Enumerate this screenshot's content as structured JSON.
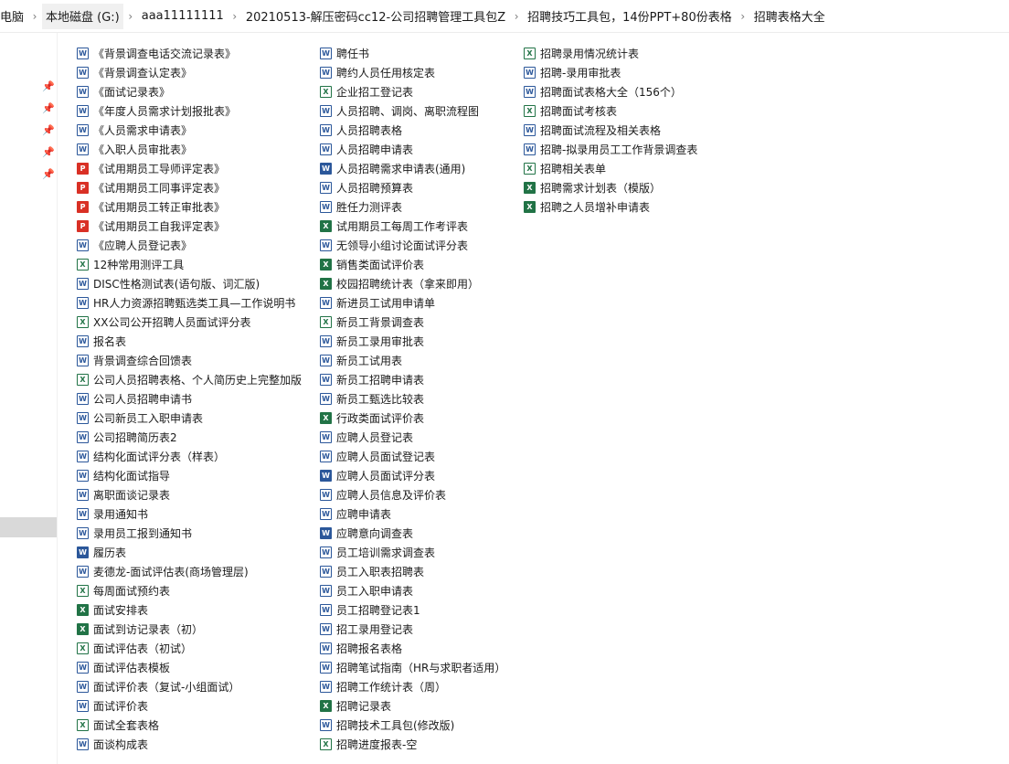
{
  "breadcrumb": [
    "电脑",
    "本地磁盘 (G:)",
    "aaa11111111",
    "20210513-解压密码cc12-公司招聘管理工具包Z",
    "招聘技巧工具包，14份PPT+80份表格",
    "招聘表格大全"
  ],
  "breadcrumb_separator": "›",
  "pin_glyph": "📌",
  "icon_types": {
    "word": {
      "glyph": "W",
      "color": "#2b579a"
    },
    "excel": {
      "glyph": "X",
      "color": "#217346"
    },
    "pdf": {
      "glyph": "P",
      "color": "#d93025"
    },
    "doc": {
      "glyph": "W",
      "color": "#2b579a"
    },
    "xls": {
      "glyph": "X",
      "color": "#217346"
    }
  },
  "files": {
    "col1": [
      {
        "name": "《背景调查电话交流记录表》",
        "icon": "doc"
      },
      {
        "name": "《背景调查认定表》",
        "icon": "doc"
      },
      {
        "name": "《面试记录表》",
        "icon": "doc"
      },
      {
        "name": "《年度人员需求计划报批表》",
        "icon": "doc"
      },
      {
        "name": "《人员需求申请表》",
        "icon": "doc"
      },
      {
        "name": "《入职人员审批表》",
        "icon": "doc"
      },
      {
        "name": "《试用期员工导师评定表》",
        "icon": "pdf"
      },
      {
        "name": "《试用期员工同事评定表》",
        "icon": "pdf"
      },
      {
        "name": "《试用期员工转正审批表》",
        "icon": "pdf"
      },
      {
        "name": "《试用期员工自我评定表》",
        "icon": "pdf"
      },
      {
        "name": "《应聘人员登记表》",
        "icon": "doc"
      },
      {
        "name": "12种常用测评工具",
        "icon": "xls"
      },
      {
        "name": "DISC性格测试表(语句版、词汇版)",
        "icon": "doc"
      },
      {
        "name": "HR人力资源招聘甄选类工具—工作说明书",
        "icon": "doc"
      },
      {
        "name": "XX公司公开招聘人员面试评分表",
        "icon": "xls"
      },
      {
        "name": "报名表",
        "icon": "doc"
      },
      {
        "name": "背景调查综合回馈表",
        "icon": "doc"
      },
      {
        "name": "公司人员招聘表格、个人简历史上完整加版",
        "icon": "xls"
      },
      {
        "name": "公司人员招聘申请书",
        "icon": "doc"
      },
      {
        "name": "公司新员工入职申请表",
        "icon": "doc"
      },
      {
        "name": "公司招聘简历表2",
        "icon": "doc"
      },
      {
        "name": "结构化面试评分表（样表）",
        "icon": "doc"
      },
      {
        "name": "结构化面试指导",
        "icon": "doc"
      },
      {
        "name": "离职面谈记录表",
        "icon": "doc"
      },
      {
        "name": "录用通知书",
        "icon": "doc"
      },
      {
        "name": "录用员工报到通知书",
        "icon": "doc"
      },
      {
        "name": "履历表",
        "icon": "word"
      },
      {
        "name": "麦德龙-面试评估表(商场管理层)",
        "icon": "doc"
      },
      {
        "name": "每周面试预约表",
        "icon": "xls"
      },
      {
        "name": "面试安排表",
        "icon": "excel"
      },
      {
        "name": "面试到访记录表（初）",
        "icon": "excel"
      },
      {
        "name": "面试评估表（初试）",
        "icon": "xls"
      },
      {
        "name": "面试评估表模板",
        "icon": "doc"
      },
      {
        "name": "面试评价表（复试-小组面试）",
        "icon": "doc"
      },
      {
        "name": "面试评价表",
        "icon": "doc"
      },
      {
        "name": "面试全套表格",
        "icon": "xls"
      },
      {
        "name": "面谈构成表",
        "icon": "doc"
      }
    ],
    "col2": [
      {
        "name": "聘任书",
        "icon": "doc"
      },
      {
        "name": "聘约人员任用核定表",
        "icon": "doc"
      },
      {
        "name": "企业招工登记表",
        "icon": "xls"
      },
      {
        "name": "人员招聘、调岗、离职流程图",
        "icon": "doc"
      },
      {
        "name": "人员招聘表格",
        "icon": "doc"
      },
      {
        "name": "人员招聘申请表",
        "icon": "doc"
      },
      {
        "name": "人员招聘需求申请表(通用)",
        "icon": "word"
      },
      {
        "name": "人员招聘预算表",
        "icon": "doc"
      },
      {
        "name": "胜任力测评表",
        "icon": "doc"
      },
      {
        "name": "试用期员工每周工作考评表",
        "icon": "excel"
      },
      {
        "name": "无领导小组讨论面试评分表",
        "icon": "doc"
      },
      {
        "name": "销售类面试评价表",
        "icon": "excel"
      },
      {
        "name": "校园招聘统计表（拿来即用）",
        "icon": "excel"
      },
      {
        "name": "新进员工试用申请单",
        "icon": "doc"
      },
      {
        "name": "新员工背景调查表",
        "icon": "xls"
      },
      {
        "name": "新员工录用审批表",
        "icon": "doc"
      },
      {
        "name": "新员工试用表",
        "icon": "doc"
      },
      {
        "name": "新员工招聘申请表",
        "icon": "doc"
      },
      {
        "name": "新员工甄选比较表",
        "icon": "doc"
      },
      {
        "name": "行政类面试评价表",
        "icon": "excel"
      },
      {
        "name": "应聘人员登记表",
        "icon": "doc"
      },
      {
        "name": "应聘人员面试登记表",
        "icon": "doc"
      },
      {
        "name": "应聘人员面试评分表",
        "icon": "word"
      },
      {
        "name": "应聘人员信息及评价表",
        "icon": "doc"
      },
      {
        "name": "应聘申请表",
        "icon": "doc"
      },
      {
        "name": "应聘意向调查表",
        "icon": "word"
      },
      {
        "name": "员工培训需求调查表",
        "icon": "doc"
      },
      {
        "name": "员工入职表招聘表",
        "icon": "doc"
      },
      {
        "name": "员工入职申请表",
        "icon": "doc"
      },
      {
        "name": "员工招聘登记表1",
        "icon": "doc"
      },
      {
        "name": "招工录用登记表",
        "icon": "doc"
      },
      {
        "name": "招聘报名表格",
        "icon": "doc"
      },
      {
        "name": "招聘笔试指南（HR与求职者适用）",
        "icon": "doc"
      },
      {
        "name": "招聘工作统计表（周）",
        "icon": "doc"
      },
      {
        "name": "招聘记录表",
        "icon": "excel"
      },
      {
        "name": "招聘技术工具包(修改版)",
        "icon": "doc"
      },
      {
        "name": "招聘进度报表-空",
        "icon": "xls"
      }
    ],
    "col3": [
      {
        "name": "招聘录用情况统计表",
        "icon": "xls"
      },
      {
        "name": "招聘-录用审批表",
        "icon": "doc"
      },
      {
        "name": "招聘面试表格大全（156个）",
        "icon": "doc"
      },
      {
        "name": "招聘面试考核表",
        "icon": "xls"
      },
      {
        "name": "招聘面试流程及相关表格",
        "icon": "doc"
      },
      {
        "name": "招聘-拟录用员工工作背景调查表",
        "icon": "doc"
      },
      {
        "name": "招聘相关表单",
        "icon": "xls"
      },
      {
        "name": "招聘需求计划表（模版）",
        "icon": "excel"
      },
      {
        "name": "招聘之人员增补申请表",
        "icon": "excel"
      }
    ]
  }
}
